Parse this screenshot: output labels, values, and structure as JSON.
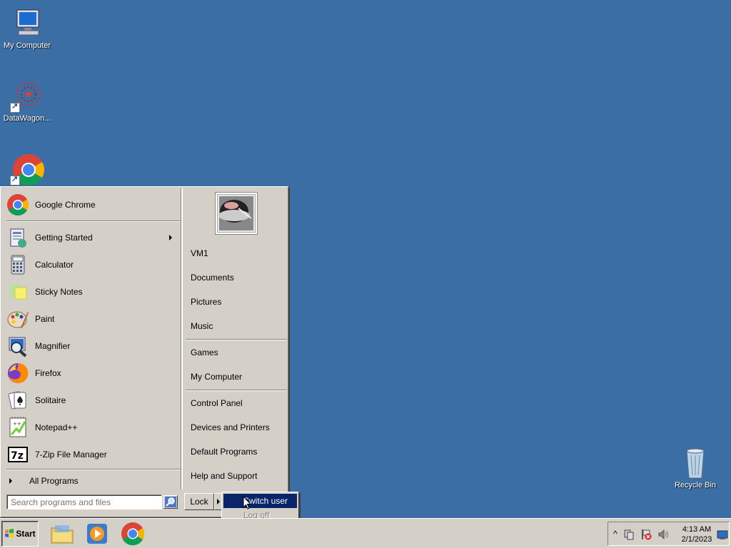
{
  "desktop": {
    "icons": [
      {
        "label": "My Computer"
      },
      {
        "label": "DataWagon..."
      },
      {
        "label": "Google Chrome"
      },
      {
        "label": "Recycle Bin"
      }
    ]
  },
  "start_menu": {
    "pinned": [
      {
        "label": "Google Chrome",
        "icon": "chrome-icon"
      }
    ],
    "recent": [
      {
        "label": "Getting Started",
        "icon": "getting-started-icon",
        "has_submenu": true
      },
      {
        "label": "Calculator",
        "icon": "calculator-icon"
      },
      {
        "label": "Sticky Notes",
        "icon": "sticky-notes-icon"
      },
      {
        "label": "Paint",
        "icon": "paint-icon"
      },
      {
        "label": "Magnifier",
        "icon": "magnifier-icon"
      },
      {
        "label": "Firefox",
        "icon": "firefox-icon"
      },
      {
        "label": "Solitaire",
        "icon": "solitaire-icon"
      },
      {
        "label": "Notepad++",
        "icon": "notepadpp-icon"
      },
      {
        "label": "7-Zip File Manager",
        "icon": "7zip-icon"
      }
    ],
    "all_programs": "All Programs",
    "search_placeholder": "Search programs and files",
    "right": {
      "user": "VM1",
      "documents": "Documents",
      "pictures": "Pictures",
      "music": "Music",
      "games": "Games",
      "my_computer": "My Computer",
      "control_panel": "Control Panel",
      "devices": "Devices and Printers",
      "default_programs": "Default Programs",
      "help": "Help and Support"
    },
    "lock_label": "Lock",
    "submenu": {
      "switch_user": "Switch user",
      "log_off": "Log off"
    }
  },
  "taskbar": {
    "start_label": "Start",
    "clock_time": "4:13 AM",
    "clock_date": "2/1/2023"
  },
  "colors": {
    "desktop": "#3a6ea5",
    "menu": "#d4d0c8",
    "highlight": "#0a246a"
  }
}
